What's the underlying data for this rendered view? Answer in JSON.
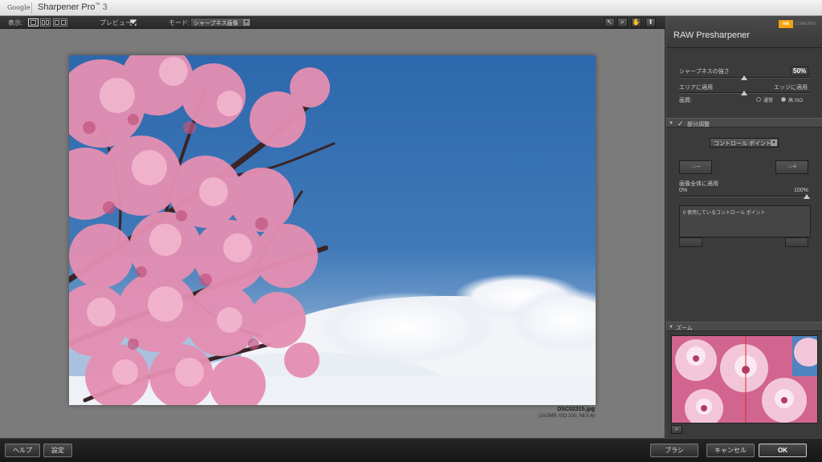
{
  "titlebar": {
    "brand": "Google",
    "app_name": "Sharpener Pro",
    "tm": "™",
    "version": "3"
  },
  "toolbar": {
    "view_label": "表示:",
    "preview_label": "プレビュー:",
    "preview_checked": true,
    "mode_label": "モード:",
    "mode_value": "シャープネス画像",
    "tools": [
      "arrow-icon",
      "zoom-icon",
      "hand-icon",
      "pin-icon"
    ]
  },
  "image": {
    "file_name": "DSC02315.jpg",
    "file_info": "(16.0MP, ISO 100, NEX-6)"
  },
  "panel": {
    "title": "RAW Presharpener",
    "logo_text": "nik",
    "logo_sub": "Collection",
    "sharpness_label": "シャープネスの強さ",
    "sharpness_value": "50%",
    "area_label": "エリアに適用",
    "edge_label": "エッジに適用",
    "quality_label": "画質:",
    "quality_normal": "通常",
    "quality_high_iso": "高 ISO",
    "quality_selected": "高 ISO",
    "partial_label": "部分調整",
    "control_point_dropdown": "コントロール ポイント",
    "apply_whole_label": "画像全体に適用",
    "apply_min": "0%",
    "apply_max": "100%",
    "control_points_text": "0 使用しているコントロール ポイント",
    "zoom_label": "ズーム"
  },
  "bottom": {
    "help_label": "ヘルプ",
    "settings_label": "設定",
    "brush_label": "ブラシ",
    "cancel_label": "キャンセル",
    "ok_label": "OK"
  },
  "colors": {
    "sky": "#3f79b8",
    "blossom": "#e58fb2",
    "panel_bg": "#3b3b3b",
    "canvas_bg": "#7b7b7b",
    "logo_orange": "#f6a20b"
  }
}
